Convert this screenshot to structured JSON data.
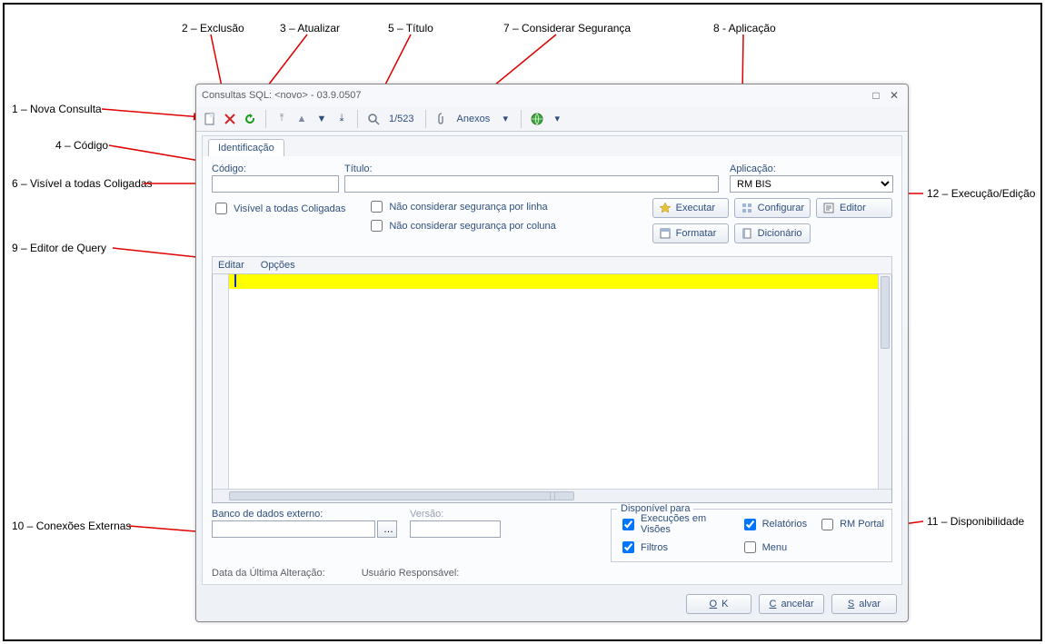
{
  "annotations": {
    "a1": "1 – Nova Consulta",
    "a2": "2 – Exclusão",
    "a3": "3 – Atualizar",
    "a4": "4 – Código",
    "a5": "5 – Título",
    "a6": "6 – Visível a todas Coligadas",
    "a7": "7 – Considerar Segurança",
    "a8": "8 - Aplicação",
    "a9": "9 – Editor de Query",
    "a10": "10 – Conexões Externas",
    "a11": "11 – Disponibilidade",
    "a12": "12 – Execução/Edição"
  },
  "window": {
    "title": "Consultas SQL: <novo> - 03.9.0507"
  },
  "toolbar": {
    "counter": "1/523",
    "anexos": "Anexos"
  },
  "tab": {
    "identificacao": "Identificação"
  },
  "fields": {
    "codigo_label": "Código:",
    "titulo_label": "Título:",
    "aplicacao_label": "Aplicação:",
    "aplicacao_value": "RM BIS",
    "visivel_label": "Visível a todas Coligadas",
    "seg_linha": "Não considerar segurança por linha",
    "seg_coluna": "Não considerar segurança por coluna"
  },
  "exec_buttons": {
    "executar": "Executar",
    "configurar": "Configurar",
    "editor": "Editor",
    "formatar": "Formatar",
    "dicionario": "Dicionário"
  },
  "editor_menu": {
    "editar": "Editar",
    "opcoes": "Opções"
  },
  "lower": {
    "banco_label": "Banco de dados externo:",
    "versao_label": "Versão:",
    "disp_title": "Disponível para",
    "exec_visoes": "Execuções em Visões",
    "relatorios": "Relatórios",
    "rm_portal": "RM Portal",
    "filtros": "Filtros",
    "menu": "Menu"
  },
  "footer": {
    "data_alt": "Data da Última Alteração:",
    "usuario": "Usuário Responsável:"
  },
  "dialog_buttons": {
    "ok": "OK",
    "cancelar": "Cancelar",
    "salvar": "Salvar"
  }
}
